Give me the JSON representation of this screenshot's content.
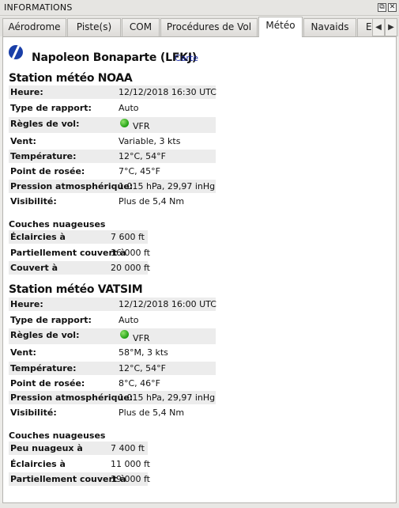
{
  "window": {
    "title": "INFORMATIONS",
    "restore_glyph": "⧉",
    "close_glyph": "✕"
  },
  "tabs": [
    {
      "label": "Aérodrome"
    },
    {
      "label": "Piste(s)"
    },
    {
      "label": "COM"
    },
    {
      "label": "Procédures de Vol"
    },
    {
      "label": "Météo",
      "active": true
    },
    {
      "label": "Navaids"
    },
    {
      "label": "E"
    }
  ],
  "tab_nav": {
    "left": "◀",
    "right": "▶"
  },
  "airport": {
    "name": "Napoleon Bonaparte (LFKJ)",
    "map_link": "Carte",
    "icon": "airport-icon"
  },
  "noaa": {
    "title": "Station météo NOAA",
    "rows": [
      {
        "label": "Heure:",
        "value": "12/12/2018 16:30 UTC"
      },
      {
        "label": "Type de rapport:",
        "value": "Auto"
      },
      {
        "label": "Règles de vol:",
        "value": "VFR"
      },
      {
        "label": "Vent:",
        "value": "Variable, 3 kts"
      },
      {
        "label": "Température:",
        "value": "12°C, 54°F"
      },
      {
        "label": "Point de rosée:",
        "value": "7°C, 45°F"
      },
      {
        "label": "Pression atmosphérique:",
        "value": "1 015 hPa, 29,97 inHg"
      },
      {
        "label": "Visibilité:",
        "value": "Plus de 5,4 Nm"
      }
    ],
    "clouds_title": "Couches nuageuses",
    "clouds": [
      {
        "label": "Éclaircies à",
        "value": "7 600 ft"
      },
      {
        "label": "Partiellement couvert à",
        "value": "16 000 ft"
      },
      {
        "label": "Couvert à",
        "value": "20 000 ft"
      }
    ]
  },
  "vatsim": {
    "title": "Station météo VATSIM",
    "rows": [
      {
        "label": "Heure:",
        "value": "12/12/2018 16:00 UTC"
      },
      {
        "label": "Type de rapport:",
        "value": "Auto"
      },
      {
        "label": "Règles de vol:",
        "value": "VFR"
      },
      {
        "label": "Vent:",
        "value": "58°M, 3 kts"
      },
      {
        "label": "Température:",
        "value": "12°C, 54°F"
      },
      {
        "label": "Point de rosée:",
        "value": "8°C, 46°F"
      },
      {
        "label": "Pression atmosphérique:",
        "value": "1 015 hPa, 29,97 inHg"
      },
      {
        "label": "Visibilité:",
        "value": "Plus de 5,4 Nm"
      }
    ],
    "clouds_title": "Couches nuageuses",
    "clouds": [
      {
        "label": "Peu nuageux à",
        "value": "7 400 ft"
      },
      {
        "label": "Éclaircies à",
        "value": "11 000 ft"
      },
      {
        "label": "Partiellement couvert à",
        "value": "19 000 ft"
      }
    ]
  },
  "colors": {
    "vfr": "#1f9e12",
    "link": "#1f2fa3",
    "row_shade": "#ececec"
  }
}
